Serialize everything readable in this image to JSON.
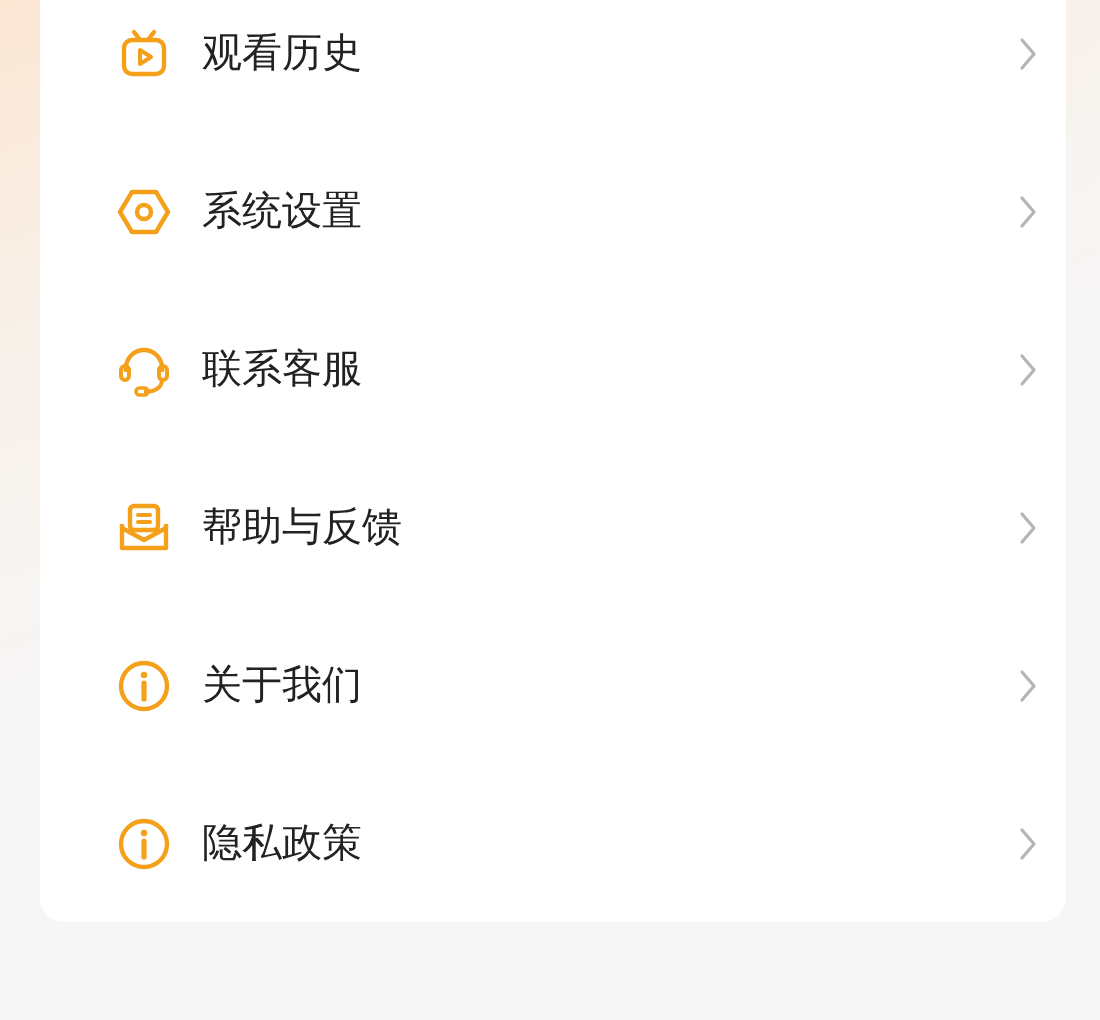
{
  "menu": {
    "items": [
      {
        "label": "观看历史"
      },
      {
        "label": "系统设置"
      },
      {
        "label": "联系客服"
      },
      {
        "label": "帮助与反馈"
      },
      {
        "label": "关于我们"
      },
      {
        "label": "隐私政策"
      }
    ]
  }
}
